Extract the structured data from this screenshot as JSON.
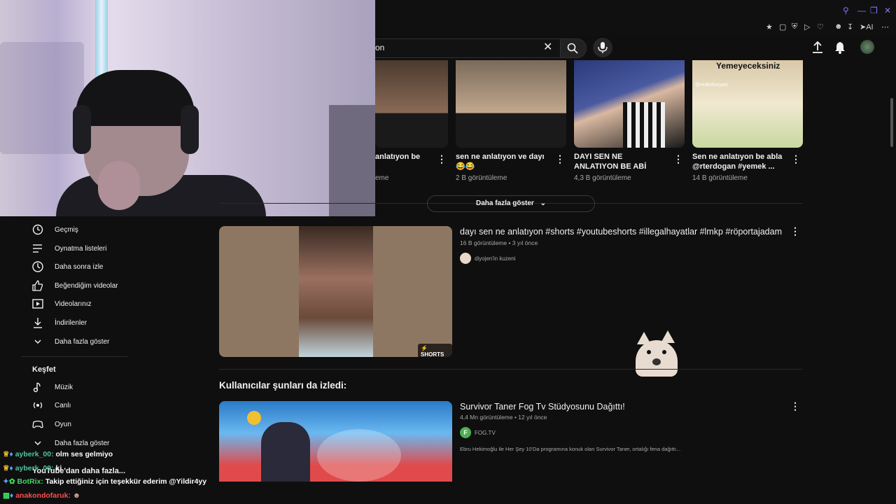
{
  "search": {
    "query": "on"
  },
  "browser": {
    "ai_label": "AI"
  },
  "shorts": [
    {
      "title": "anlatıyon be",
      "views": "eme"
    },
    {
      "title": "sen ne anlatıyon ve dayı😂😂",
      "views": "2 B görüntüleme"
    },
    {
      "title": "DAYI SEN NE ANLATIYON BE ABİ",
      "views": "4,3 B görüntüleme"
    },
    {
      "title": "Sen ne anlatıyon be abla @rterdogan #yemek ...",
      "views": "14 B görüntüleme",
      "thumb_caption": "Yemeyeceksiniz",
      "thumb_handle": "@redindunyasi"
    }
  ],
  "show_more": "Daha fazla göster",
  "sidebar": {
    "items": [
      {
        "label": "Geçmiş",
        "icon": "history-icon"
      },
      {
        "label": "Oynatma listeleri",
        "icon": "playlist-icon"
      },
      {
        "label": "Daha sonra izle",
        "icon": "clock-icon"
      },
      {
        "label": "Beğendiğim videolar",
        "icon": "thumbs-up-icon"
      },
      {
        "label": "Videolarınız",
        "icon": "video-icon"
      },
      {
        "label": "İndirilenler",
        "icon": "download-icon"
      },
      {
        "label": "Daha fazla göster",
        "icon": "chevron-down-icon"
      }
    ],
    "explore_heading": "Keşfet",
    "explore_items": [
      {
        "label": "Müzik",
        "icon": "music-icon"
      },
      {
        "label": "Canlı",
        "icon": "live-icon"
      },
      {
        "label": "Oyun",
        "icon": "gamepad-icon"
      },
      {
        "label": "Daha fazla göster",
        "icon": "chevron-down-icon"
      }
    ],
    "more_from_youtube": "YouTube'dan daha fazla..."
  },
  "video1": {
    "title": "dayı sen ne anlatıyon #shorts #youtubeshorts #illegalhayatlar #lmkp #röportajadam",
    "meta": "16 B görüntüleme • 3 yıl önce",
    "channel": "diyojen'in kuzeni",
    "badge": "SHORTS"
  },
  "section_heading": "Kullanıcılar şunları da izledi:",
  "video2": {
    "title": "Survivor Taner Fog Tv Stüdyosunu Dağıttı!",
    "meta": "4,4 Mn görüntüleme • 12 yıl önce",
    "channel": "FOG.TV",
    "channel_initial": "F",
    "description": "Ebru Hekimoğlu ile Her Şey 10'Da programına konuk olan Survivor Taner, ortalığı fena dağıttı..."
  },
  "chat": [
    {
      "user": "ayberk_00:",
      "message": "olm ses gelmiyo",
      "color": "#4fc3a1"
    },
    {
      "user": "ayberk_00:",
      "message": "ki",
      "color": "#4fc3a1"
    },
    {
      "user": "BotRix:",
      "message": "Takip ettiğiniz için teşekkür ederim @Yildir4yy",
      "color": "#3ddc5f"
    },
    {
      "user": "anakondofaruk:",
      "message": "",
      "color": "#ff4d4d"
    }
  ]
}
